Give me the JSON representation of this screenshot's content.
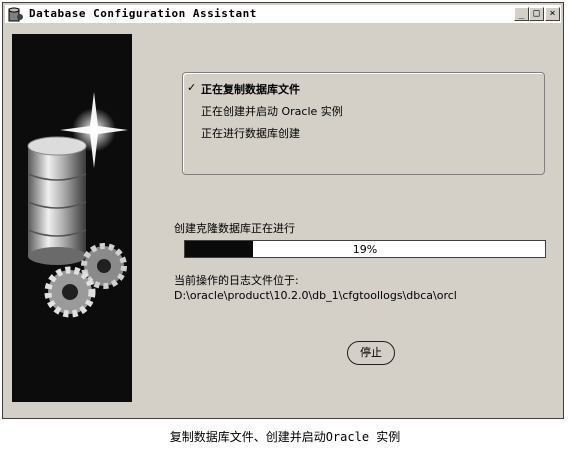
{
  "window": {
    "title": "Database Configuration Assistant",
    "minimize_glyph": "_",
    "maximize_glyph": "□",
    "close_glyph": "×"
  },
  "steps": [
    {
      "label": "正在复制数据库文件",
      "status": "current",
      "marker": "✓"
    },
    {
      "label": "正在创建并启动 Oracle 实例",
      "status": "pending"
    },
    {
      "label": "正在进行数据库创建",
      "status": "pending"
    }
  ],
  "progress": {
    "label": "创建克隆数据库正在进行",
    "percent": 19,
    "text": "19%"
  },
  "log": {
    "label": "当前操作的日志文件位于:",
    "path": "D:\\oracle\\product\\10.2.0\\db_1\\cfgtoollogs\\dbca\\orcl"
  },
  "buttons": {
    "stop_label": "停止"
  },
  "caption": "复制数据库文件、创建并启动Oracle 实例",
  "colors": {
    "window_bg": "#d4d0c8",
    "progress_fill": "#0a0a0a",
    "side_panel": "#0c0c0c"
  }
}
